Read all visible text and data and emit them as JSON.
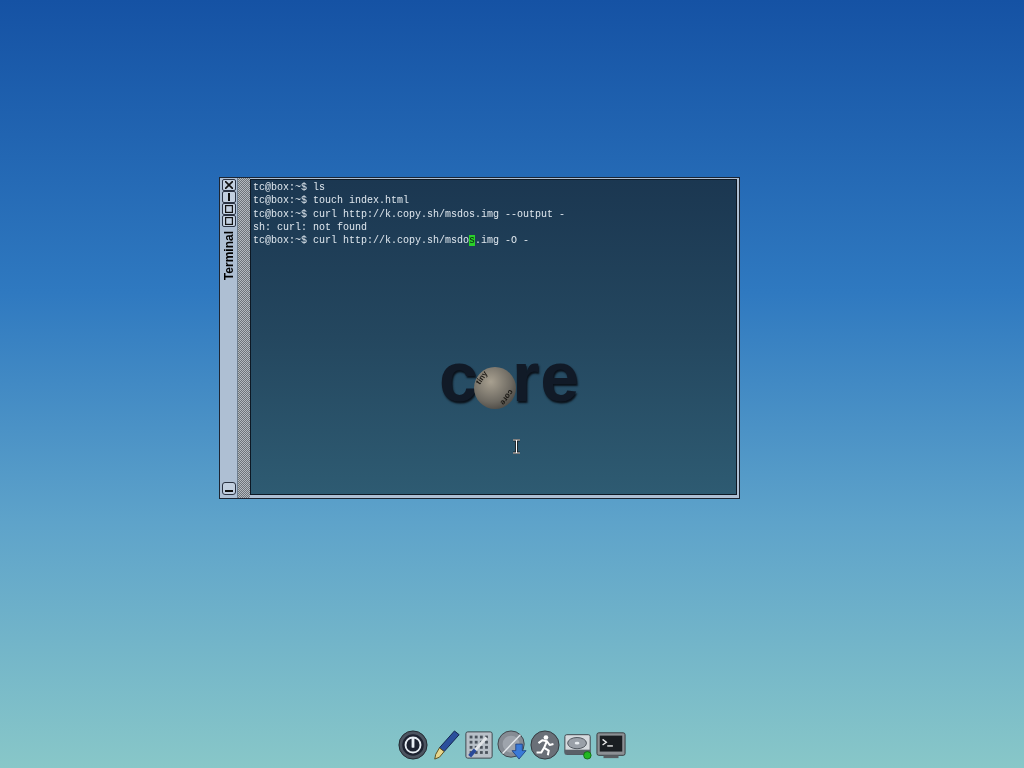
{
  "window": {
    "title": "Terminal",
    "lines": [
      "tc@box:~$ ls",
      "tc@box:~$ touch index.html",
      "tc@box:~$ curl http://k.copy.sh/msdos.img --output -",
      "sh: curl: not found"
    ],
    "input_line": {
      "before_cursor": "tc@box:~$ curl http://k.copy.sh/msdo",
      "under_cursor": "s",
      "after_cursor": ".img -O -"
    },
    "wallpaper_logo": {
      "before_sphere": "c",
      "after_sphere": "re",
      "sphere_labels": [
        "tiny",
        "core"
      ]
    }
  },
  "dock": {
    "items": [
      {
        "kind": "power"
      },
      {
        "kind": "editor"
      },
      {
        "kind": "control_panel"
      },
      {
        "kind": "apps"
      },
      {
        "kind": "run"
      },
      {
        "kind": "mount"
      },
      {
        "kind": "terminal"
      }
    ]
  }
}
